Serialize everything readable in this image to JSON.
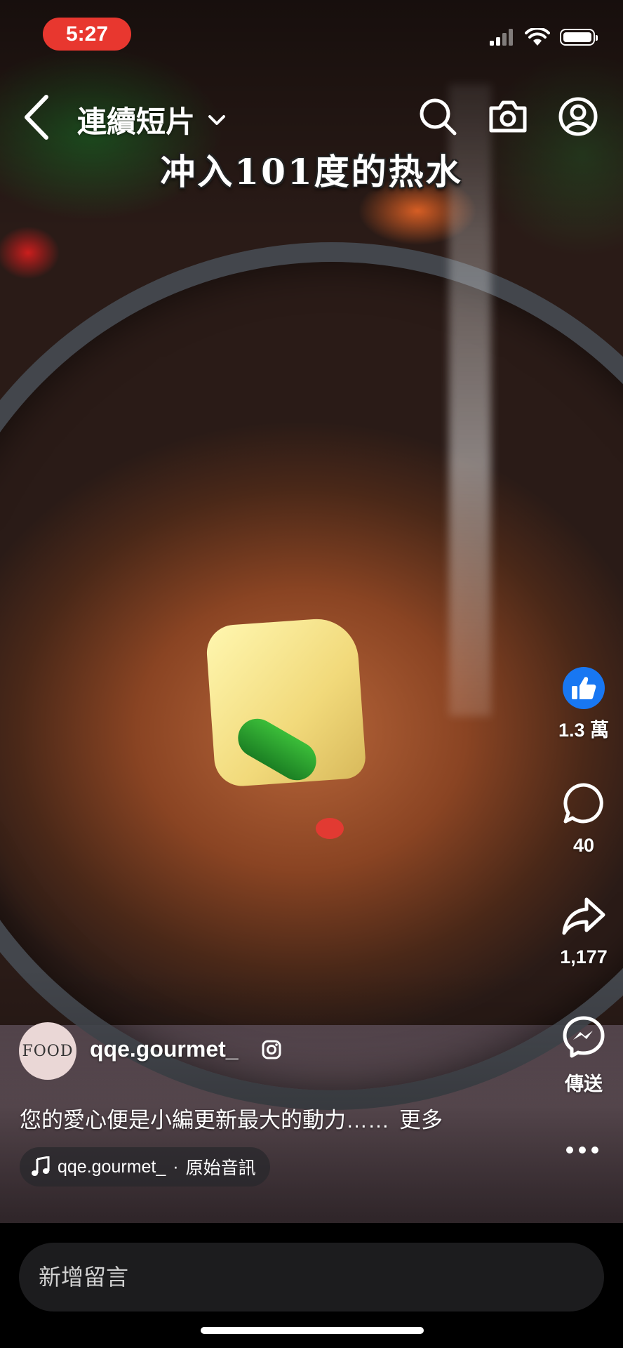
{
  "status_bar": {
    "time": "5:27",
    "time_badge_color": "#e8372f",
    "icons": [
      "signal-icon",
      "wifi-icon",
      "battery-icon"
    ]
  },
  "nav": {
    "title": "連續短片",
    "icons": [
      "back-icon",
      "chevron-down-icon",
      "search-icon",
      "camera-icon",
      "profile-icon"
    ]
  },
  "video": {
    "caption": "冲入101度的热水"
  },
  "actions": {
    "like_count": "1.3 萬",
    "comment_count": "40",
    "share_count": "1,177",
    "send_label": "傳送",
    "accent_color": "#1877f2"
  },
  "author": {
    "avatar_text": "FOOD",
    "username": "qqe.gourmet_",
    "description": "您的愛心便是小編更新最大的動力……",
    "more_label": "更多"
  },
  "audio": {
    "username": "qqe.gourmet_",
    "separator": "·",
    "label": "原始音訊"
  },
  "comment": {
    "placeholder": "新增留言"
  }
}
